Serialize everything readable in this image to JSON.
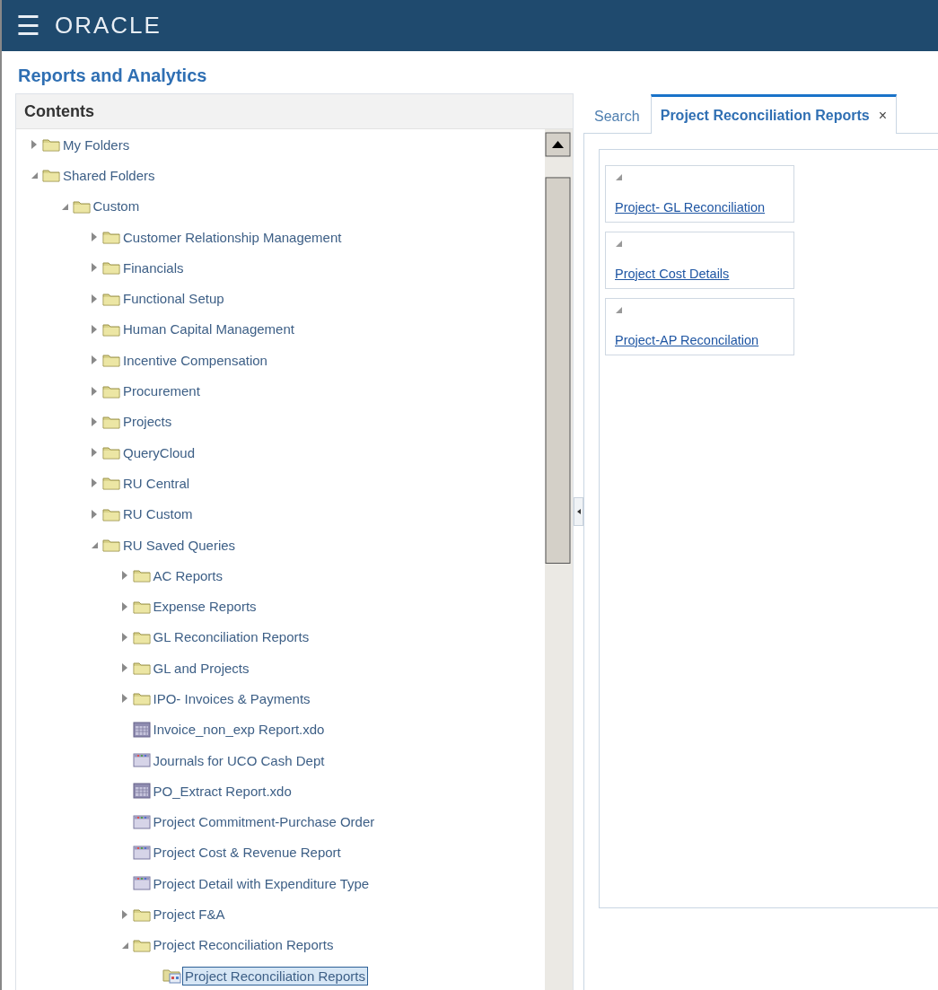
{
  "header": {
    "menu_icon": "☰",
    "logo": "ORACLE"
  },
  "page_title": "Reports and Analytics",
  "contents": {
    "title": "Contents",
    "tree": [
      {
        "label": "My Folders",
        "kind": "folder",
        "expanded": false,
        "selected": false
      },
      {
        "label": "Shared Folders",
        "kind": "folder",
        "expanded": true,
        "selected": false,
        "children": [
          {
            "label": "Custom",
            "kind": "folder",
            "expanded": true,
            "selected": false,
            "children": [
              {
                "label": "Customer Relationship Management",
                "kind": "folder",
                "expanded": false,
                "selected": false
              },
              {
                "label": "Financials",
                "kind": "folder",
                "expanded": false,
                "selected": false
              },
              {
                "label": "Functional Setup",
                "kind": "folder",
                "expanded": false,
                "selected": false
              },
              {
                "label": "Human Capital Management",
                "kind": "folder",
                "expanded": false,
                "selected": false
              },
              {
                "label": "Incentive Compensation",
                "kind": "folder",
                "expanded": false,
                "selected": false
              },
              {
                "label": "Procurement",
                "kind": "folder",
                "expanded": false,
                "selected": false
              },
              {
                "label": "Projects",
                "kind": "folder",
                "expanded": false,
                "selected": false
              },
              {
                "label": "QueryCloud",
                "kind": "folder",
                "expanded": false,
                "selected": false
              },
              {
                "label": "RU Central",
                "kind": "folder",
                "expanded": false,
                "selected": false
              },
              {
                "label": "RU Custom",
                "kind": "folder",
                "expanded": false,
                "selected": false
              },
              {
                "label": "RU Saved Queries",
                "kind": "folder",
                "expanded": true,
                "selected": false,
                "children": [
                  {
                    "label": "AC Reports",
                    "kind": "folder",
                    "expanded": false,
                    "selected": false
                  },
                  {
                    "label": "Expense Reports",
                    "kind": "folder",
                    "expanded": false,
                    "selected": false
                  },
                  {
                    "label": "GL Reconciliation Reports",
                    "kind": "folder",
                    "expanded": false,
                    "selected": false
                  },
                  {
                    "label": "GL and Projects",
                    "kind": "folder",
                    "expanded": false,
                    "selected": false
                  },
                  {
                    "label": "IPO- Invoices & Payments",
                    "kind": "folder",
                    "expanded": false,
                    "selected": false
                  },
                  {
                    "label": "Invoice_non_exp Report.xdo",
                    "kind": "report",
                    "selected": false
                  },
                  {
                    "label": "Journals for UCO Cash Dept",
                    "kind": "analysis",
                    "selected": false
                  },
                  {
                    "label": "PO_Extract Report.xdo",
                    "kind": "report",
                    "selected": false
                  },
                  {
                    "label": "Project Commitment-Purchase Order",
                    "kind": "analysis",
                    "selected": false
                  },
                  {
                    "label": "Project Cost & Revenue Report",
                    "kind": "analysis",
                    "selected": false
                  },
                  {
                    "label": "Project Detail with Expenditure Type",
                    "kind": "analysis",
                    "selected": false
                  },
                  {
                    "label": "Project F&A",
                    "kind": "folder",
                    "expanded": false,
                    "selected": false
                  },
                  {
                    "label": "Project Reconciliation Reports",
                    "kind": "folder",
                    "expanded": true,
                    "selected": false,
                    "children": [
                      {
                        "label": "Project Reconciliation Reports",
                        "kind": "dashboard",
                        "selected": true
                      }
                    ]
                  }
                ]
              }
            ]
          }
        ]
      }
    ]
  },
  "tabs": [
    {
      "label": "Search",
      "selected": false
    },
    {
      "label": "Project Reconciliation Reports",
      "selected": true,
      "close": "×"
    }
  ],
  "cards": [
    {
      "link": "Project- GL Reconciliation"
    },
    {
      "link": "Project Cost Details"
    },
    {
      "link": "Project-AP Reconcilation"
    }
  ]
}
